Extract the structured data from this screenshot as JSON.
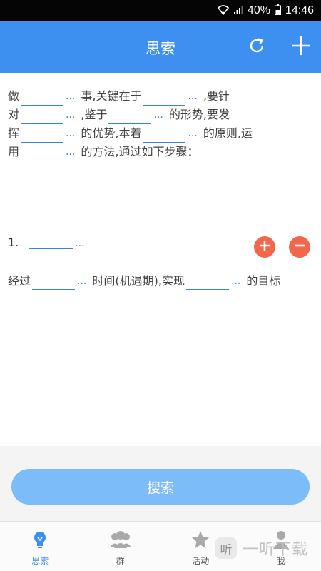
{
  "status_bar": {
    "battery": "40%",
    "time": "14:46"
  },
  "app_bar": {
    "title": "思索"
  },
  "template_lines": [
    [
      "做",
      "...",
      "事,关键在于",
      "...",
      ",要针"
    ],
    [
      "对",
      "...",
      ",鉴于",
      "...",
      "的形势,要发"
    ],
    [
      "挥",
      "...",
      "的优势,本着",
      "...",
      "的原则,运"
    ],
    [
      "用",
      "...",
      "的方法,通过如下步骤："
    ]
  ],
  "step": {
    "number": "1.",
    "dots": "..."
  },
  "goal_line": [
    "经过",
    "...",
    "时间(机遇期),实现",
    "...",
    "的目标"
  ],
  "search_button": "搜索",
  "tabs": [
    {
      "label": "思索",
      "icon": "lightbulb-icon",
      "active": true
    },
    {
      "label": "群",
      "icon": "group-icon",
      "active": false
    },
    {
      "label": "活动",
      "icon": "star-icon",
      "active": false
    },
    {
      "label": "我",
      "icon": "person-icon",
      "active": false
    }
  ],
  "watermark": {
    "badge": "听",
    "text": "一听下载"
  },
  "colors": {
    "primary": "#3d8ff0",
    "accent": "#f0674c",
    "button": "#7cbcf8"
  }
}
